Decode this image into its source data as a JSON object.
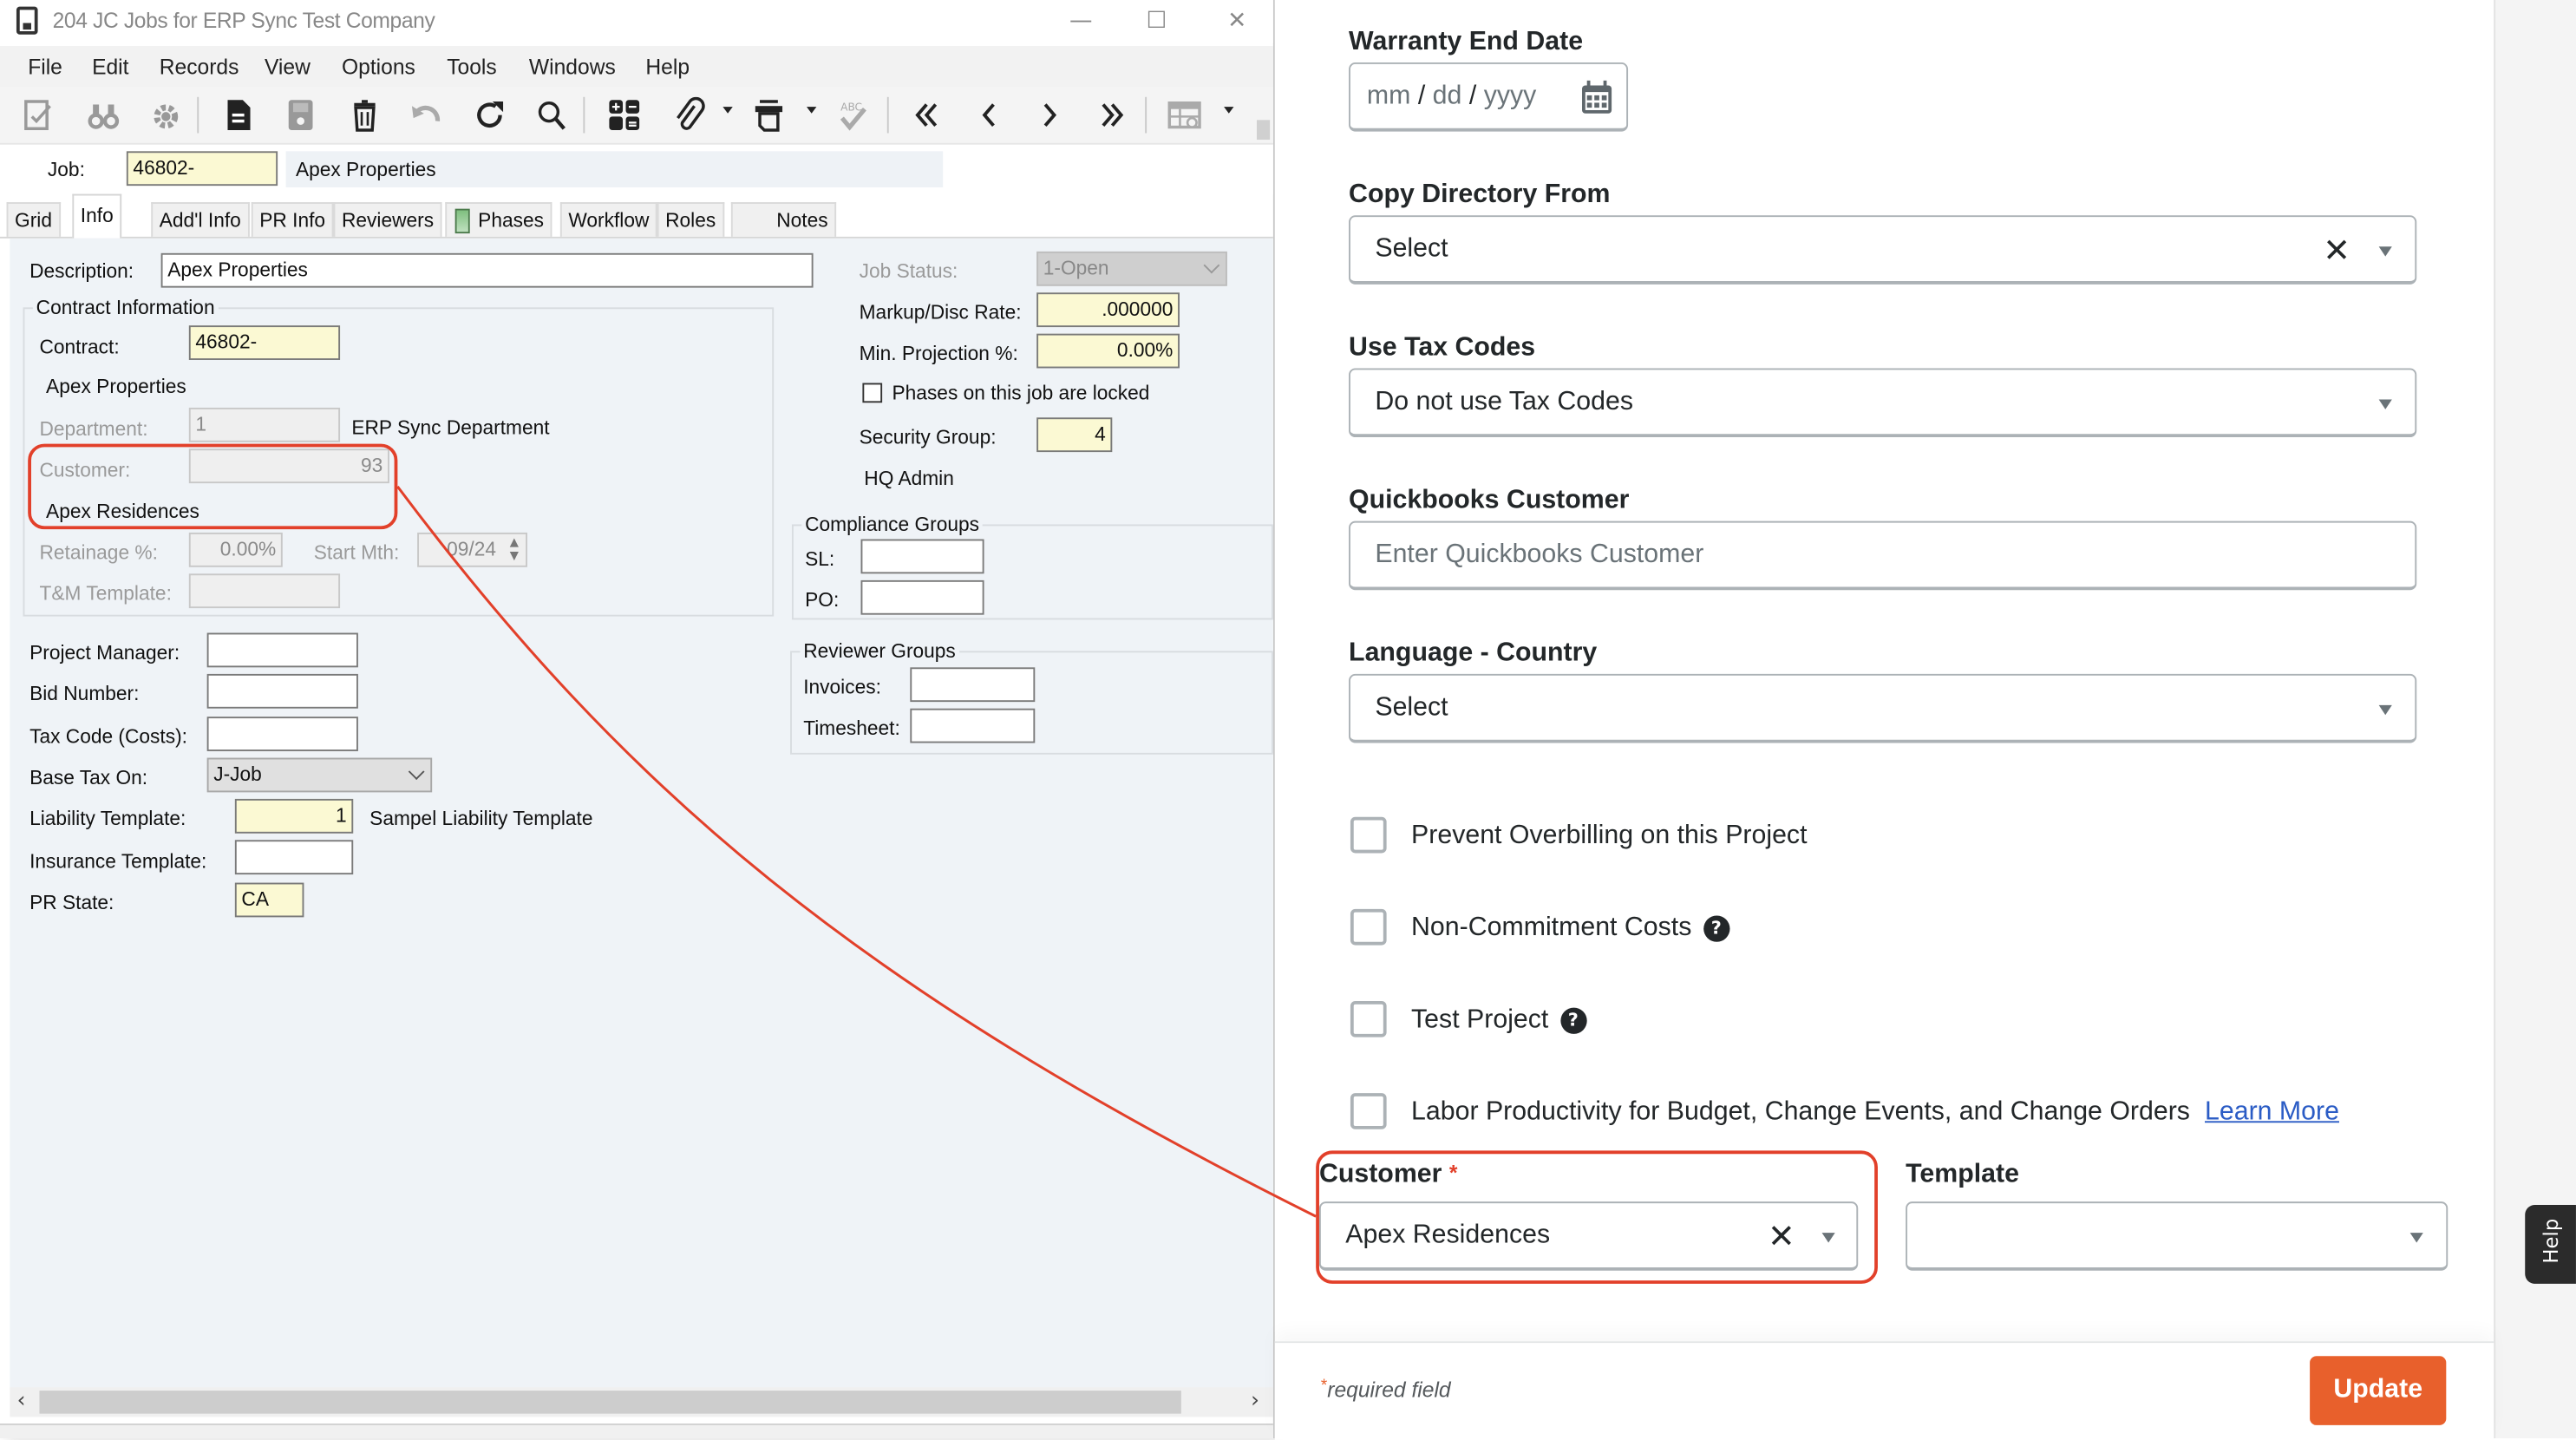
{
  "window": {
    "title": "204 JC Jobs for ERP Sync Test Company",
    "controls": {
      "minimize": "—",
      "maximize": "☐",
      "close": "✕"
    }
  },
  "menu": [
    "File",
    "Edit",
    "Records",
    "View",
    "Options",
    "Tools",
    "Windows",
    "Help"
  ],
  "toolbar": {
    "icons": [
      "edit-check-icon",
      "binoculars-icon",
      "settings-icon",
      "new-record-icon",
      "save-icon",
      "delete-icon",
      "undo-icon",
      "refresh-icon",
      "search-icon",
      "calculator-icon",
      "attachment-icon",
      "print-icon",
      "spellcheck-icon",
      "first-record-icon",
      "previous-record-icon",
      "next-record-icon",
      "last-record-icon",
      "grid-settings-icon"
    ]
  },
  "job": {
    "label": "Job:",
    "value": "46802-",
    "description": "Apex Properties"
  },
  "tabs": [
    "Grid",
    "Info",
    "Add'l Info",
    "PR Info",
    "Reviewers",
    "Phases",
    "Workflow",
    "Roles",
    "Notes"
  ],
  "active_tab": "Info",
  "info": {
    "description_label": "Description:",
    "description_value": "Apex Properties",
    "contract_group": "Contract Information",
    "contract_label": "Contract:",
    "contract_value": "46802-",
    "contract_name": "Apex Properties",
    "department_label": "Department:",
    "department_value": "1",
    "department_name": "ERP Sync Department",
    "customer_label": "Customer:",
    "customer_value": "93",
    "customer_name": "Apex Residences",
    "retainage_label": "Retainage %:",
    "retainage_value": "0.00%",
    "start_mth_label": "Start Mth:",
    "start_mth_value": "09/24",
    "tm_template_label": "T&M Template:",
    "tm_template_value": "",
    "job_status_label": "Job Status:",
    "job_status_value": "1-Open",
    "markup_label": "Markup/Disc Rate:",
    "markup_value": ".000000",
    "min_projection_label": "Min. Projection %:",
    "min_projection_value": "0.00%",
    "phases_locked_label": "Phases on this job are locked",
    "phases_locked_checked": false,
    "security_group_label": "Security Group:",
    "security_group_value": "4",
    "security_group_name": "HQ Admin",
    "compliance_group": "Compliance Groups",
    "sl_label": "SL:",
    "sl_value": "",
    "po_label": "PO:",
    "po_value": "",
    "reviewer_group": "Reviewer Groups",
    "invoices_label": "Invoices:",
    "invoices_value": "",
    "timesheet_label": "Timesheet:",
    "timesheet_value": "",
    "project_manager_label": "Project Manager:",
    "project_manager_value": "",
    "bid_number_label": "Bid Number:",
    "bid_number_value": "",
    "tax_code_label": "Tax Code (Costs):",
    "tax_code_value": "",
    "base_tax_label": "Base Tax On:",
    "base_tax_value": "J-Job",
    "liability_label": "Liability Template:",
    "liability_value": "1",
    "liability_name": "Sampel Liability Template",
    "insurance_label": "Insurance Template:",
    "insurance_value": "",
    "pr_state_label": "PR State:",
    "pr_state_value": "CA"
  },
  "scrollbar": {
    "left_arrow": "‹",
    "right_arrow": "›"
  },
  "web_form": {
    "warranty_label": "Warranty End Date",
    "warranty_placeholder": {
      "mm": "mm",
      "dd": "dd",
      "yyyy": "yyyy",
      "sep": "/"
    },
    "copy_directory_label": "Copy Directory From",
    "copy_directory_value": "Select",
    "use_tax_codes_label": "Use Tax Codes",
    "use_tax_codes_value": "Do not use Tax Codes",
    "quickbooks_label": "Quickbooks Customer",
    "quickbooks_placeholder": "Enter Quickbooks Customer",
    "language_label": "Language - Country",
    "language_value": "Select",
    "checkboxes": [
      {
        "label": "Prevent Overbilling on this Project",
        "checked": false,
        "help": false
      },
      {
        "label": "Non-Commitment Costs",
        "checked": false,
        "help": true
      },
      {
        "label": "Test Project",
        "checked": false,
        "help": true
      },
      {
        "label": "Labor Productivity for Budget, Change Events, and Change Orders",
        "checked": false,
        "help": false,
        "link": "Learn More"
      }
    ],
    "customer_label": "Customer",
    "customer_required_mark": "*",
    "customer_value": "Apex Residences",
    "template_label": "Template",
    "template_value": "",
    "clear_glyph": "✕",
    "help_glyph": "?",
    "required_note": "required field",
    "required_note_mark": "*",
    "update_label": "Update",
    "help_tab": "Help"
  },
  "colors": {
    "callout_red": "#e2402a",
    "update_orange": "#e8602c",
    "link_blue": "#2b5cc5",
    "required_yellow": "#fbf9d3",
    "form_bg": "#eff3f7"
  }
}
